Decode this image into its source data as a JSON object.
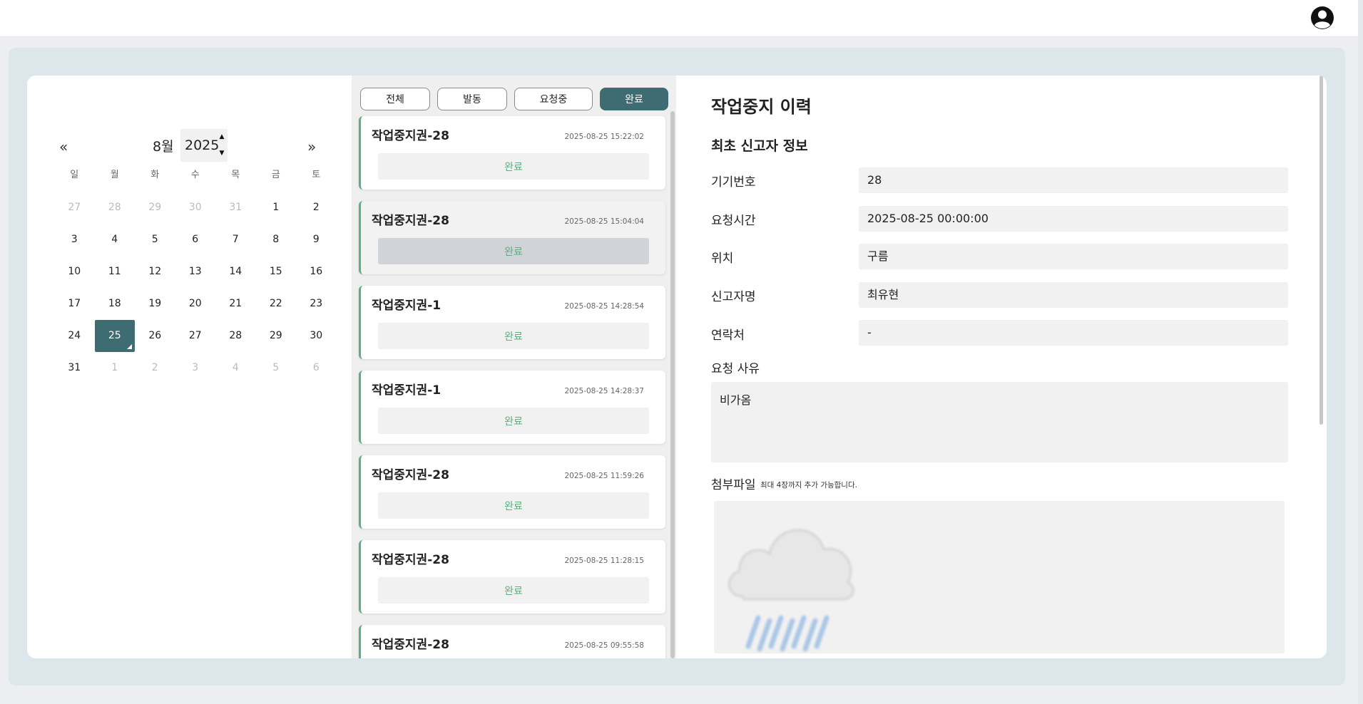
{
  "colors": {
    "accent": "#3f6b72",
    "status_green": "#5fae80"
  },
  "header": {
    "profile_icon": "user-circle-icon"
  },
  "calendar": {
    "prev_icon": "«",
    "next_icon": "»",
    "month": "8월",
    "year": "2025",
    "weekdays": [
      "일",
      "월",
      "화",
      "수",
      "목",
      "금",
      "토"
    ],
    "weeks": [
      [
        "27",
        "28",
        "29",
        "30",
        "31",
        "1",
        "2"
      ],
      [
        "3",
        "4",
        "5",
        "6",
        "7",
        "8",
        "9"
      ],
      [
        "10",
        "11",
        "12",
        "13",
        "14",
        "15",
        "16"
      ],
      [
        "17",
        "18",
        "19",
        "20",
        "21",
        "22",
        "23"
      ],
      [
        "24",
        "25",
        "26",
        "27",
        "28",
        "29",
        "30"
      ],
      [
        "31",
        "1",
        "2",
        "3",
        "4",
        "5",
        "6"
      ]
    ],
    "selected_day": "25"
  },
  "filters": [
    {
      "label": "전체"
    },
    {
      "label": "발동"
    },
    {
      "label": "요청중"
    },
    {
      "label": "완료"
    }
  ],
  "active_filter": "완료",
  "cards": [
    {
      "title": "작업중지권-28",
      "time": "2025-08-25 15:22:02",
      "status": "완료"
    },
    {
      "title": "작업중지권-28",
      "time": "2025-08-25 15:04:04",
      "status": "완료"
    },
    {
      "title": "작업중지권-1",
      "time": "2025-08-25 14:28:54",
      "status": "완료"
    },
    {
      "title": "작업중지권-1",
      "time": "2025-08-25 14:28:37",
      "status": "완료"
    },
    {
      "title": "작업중지권-28",
      "time": "2025-08-25 11:59:26",
      "status": "완료"
    },
    {
      "title": "작업중지권-28",
      "time": "2025-08-25 11:28:15",
      "status": "완료"
    },
    {
      "title": "작업중지권-28",
      "time": "2025-08-25 09:55:58",
      "status": "완료"
    }
  ],
  "detail": {
    "title": "작업중지 이력",
    "subtitle": "최초 신고자 정보",
    "fields": [
      {
        "label": "기기번호",
        "value": "28"
      },
      {
        "label": "요청시간",
        "value": "2025-08-25 00:00:00"
      },
      {
        "label": "위치",
        "value": "구름"
      },
      {
        "label": "신고자명",
        "value": "최유현"
      },
      {
        "label": "연락처",
        "value": "-"
      }
    ],
    "reason_label": "요청 사유",
    "reason_value": "비가옴",
    "attach_label": "첨부파일",
    "attach_note": "최대 4장까지 추가 가능합니다.",
    "attach_image_icon": "rain-cloud-icon"
  }
}
